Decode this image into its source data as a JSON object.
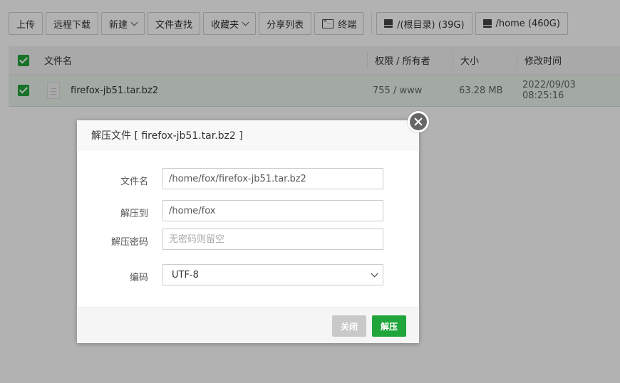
{
  "toolbar": {
    "upload": "上传",
    "remote_download": "远程下载",
    "new": "新建",
    "file_search": "文件查找",
    "favorites": "收藏夹",
    "share_list": "分享列表",
    "terminal": "终端",
    "disk_root": "/(根目录) (39G)",
    "disk_home": "/home (460G)"
  },
  "table": {
    "headers": {
      "name": "文件名",
      "perm_owner": "权限 / 所有者",
      "size": "大小",
      "mtime": "修改时间"
    },
    "rows": [
      {
        "name": "firefox-jb51.tar.bz2",
        "perm_owner": "755 / www",
        "size": "63.28 MB",
        "mtime": "2022/09/03 08:25:16"
      }
    ]
  },
  "dialog": {
    "title": "解压文件 [ firefox-jb51.tar.bz2 ]",
    "fields": {
      "filename_label": "文件名",
      "filename_value": "/home/fox/firefox-jb51.tar.bz2",
      "extract_to_label": "解压到",
      "extract_to_value": "/home/fox",
      "password_label": "解压密码",
      "password_placeholder": "无密码则留空",
      "encoding_label": "编码",
      "encoding_value": "UTF-8"
    },
    "buttons": {
      "close": "关闭",
      "extract": "解压"
    }
  },
  "colors": {
    "accent": "#20a53a",
    "disabled_button": "#c9c9c9"
  }
}
